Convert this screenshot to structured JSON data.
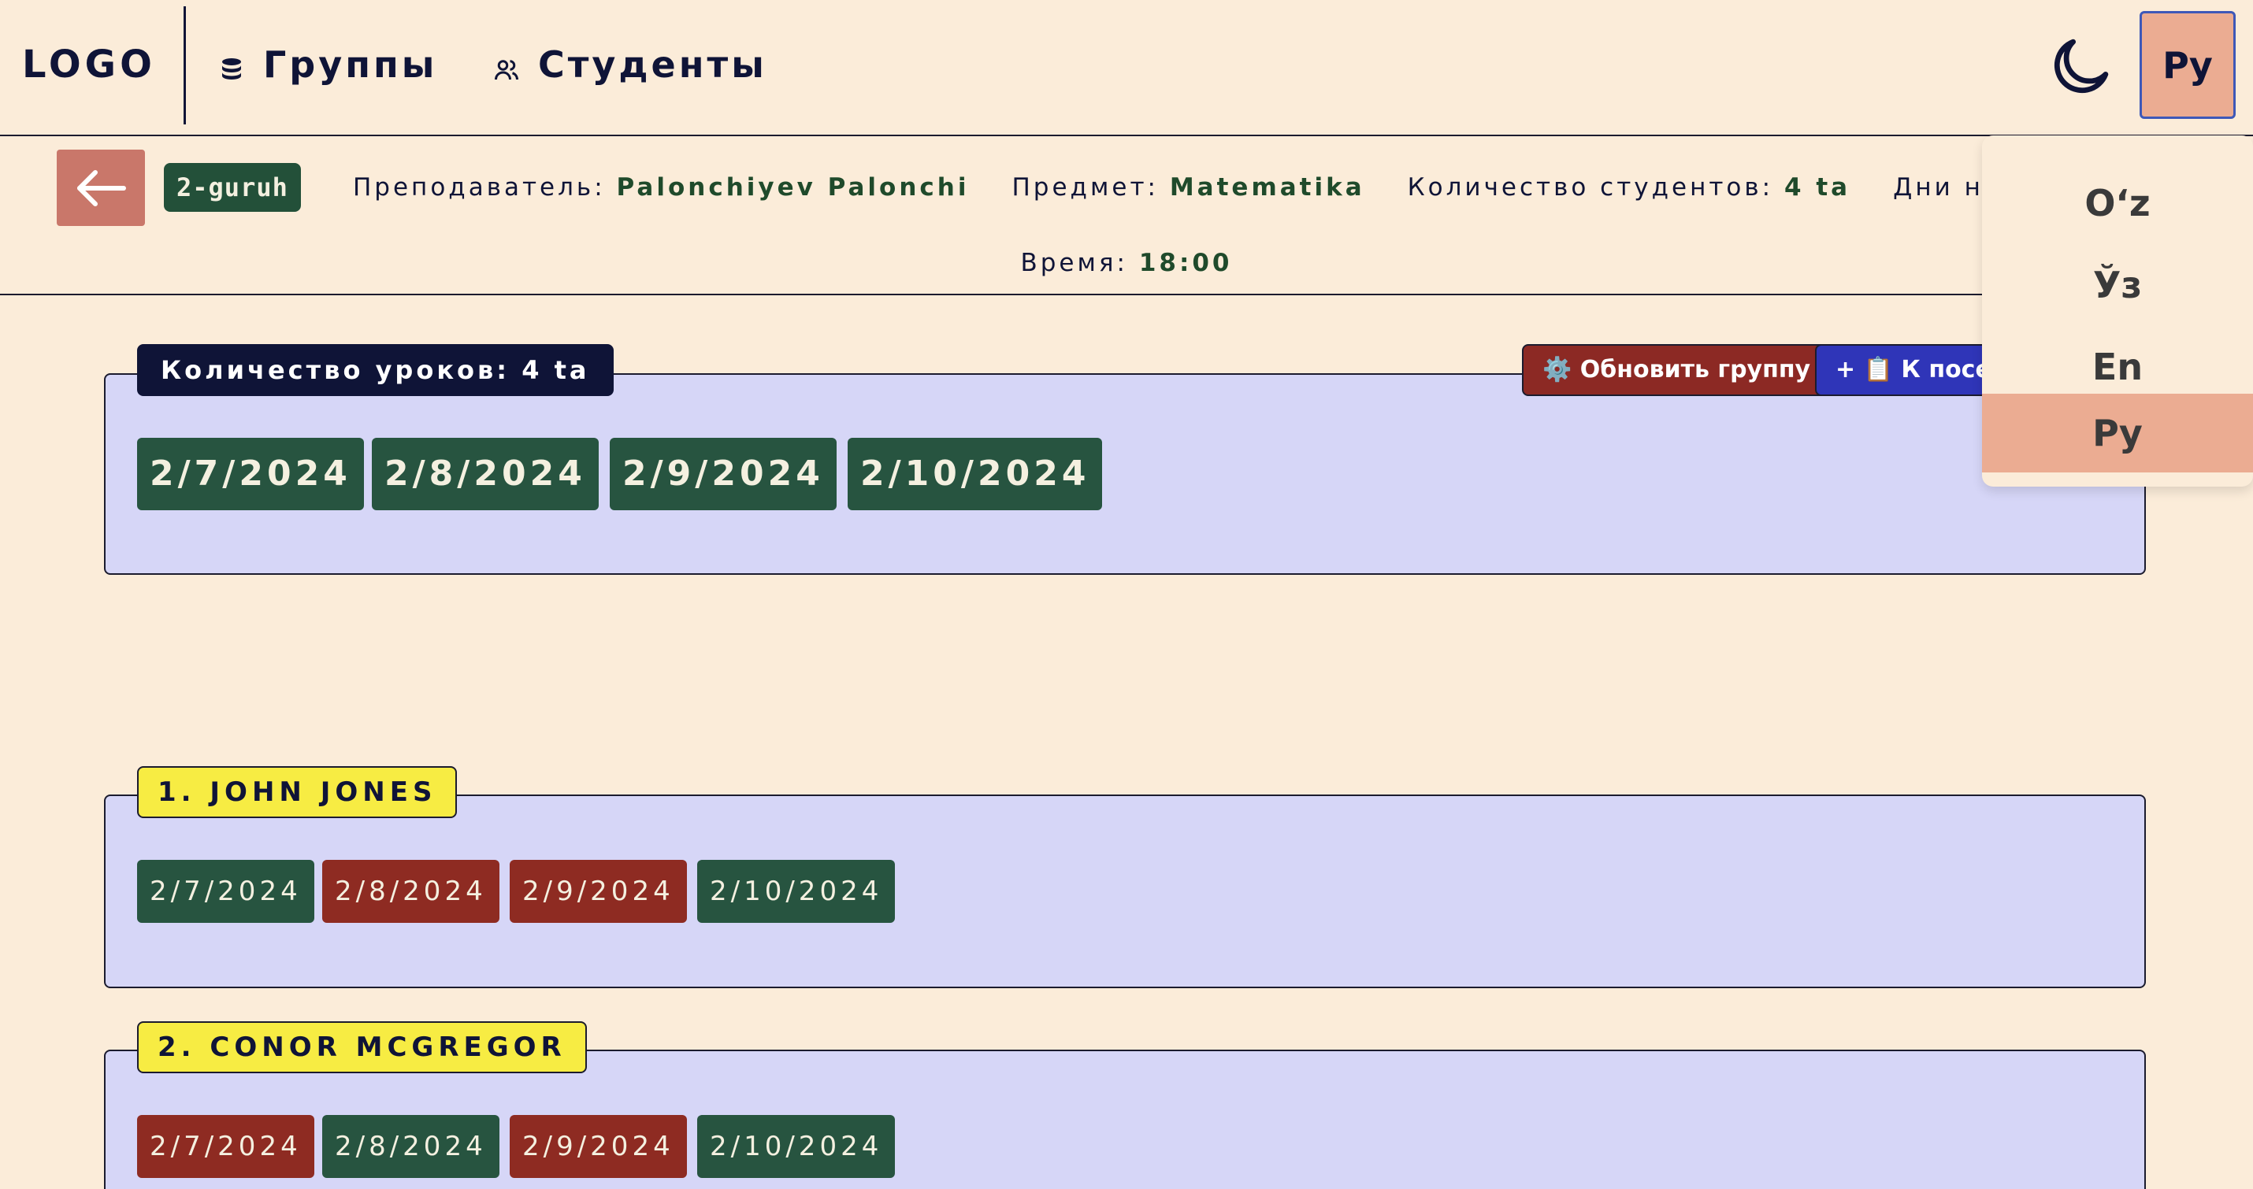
{
  "nav": {
    "logo": "LOGO",
    "groups_label": "Группы",
    "students_label": "Студенты",
    "lang_current": "Ру"
  },
  "group": {
    "name": "2-guruh",
    "teacher_label": "Преподаватель:",
    "teacher": "Palonchiyev Palonchi",
    "subject_label": "Предмет:",
    "subject": "Matematika",
    "count_label": "Количество студентов:",
    "count": "4 ta",
    "days_label": "Дни недели:",
    "time_label": "Время:",
    "time": "18:00"
  },
  "lessons": {
    "label": "Количество уроков: 4 ta",
    "dates": [
      "2/7/2024",
      "2/8/2024",
      "2/9/2024",
      "2/10/2024"
    ]
  },
  "actions": {
    "update_label": "⚙️ Обновить группу",
    "attendance_label": "+ 📋 К посещаемости"
  },
  "students": [
    {
      "label": "1. JOHN JONES",
      "dates": [
        "2/7/2024",
        "2/8/2024",
        "2/9/2024",
        "2/10/2024"
      ],
      "status": [
        "present",
        "absent",
        "absent",
        "present"
      ]
    },
    {
      "label": "2. CONOR MCGREGOR",
      "dates": [
        "2/7/2024",
        "2/8/2024",
        "2/9/2024",
        "2/10/2024"
      ],
      "status": [
        "absent",
        "present",
        "absent",
        "present"
      ]
    }
  ],
  "lang_menu": {
    "items": [
      "Oʻz",
      "Ўз",
      "En",
      "Ру"
    ],
    "active": "Ру"
  },
  "colors": {
    "background": "#fbecd9",
    "panel": "#d6d6f7",
    "present": "#275440",
    "absent": "#8e2b22",
    "accent_dark": "#0f1437",
    "student_label": "#f7ec43"
  }
}
